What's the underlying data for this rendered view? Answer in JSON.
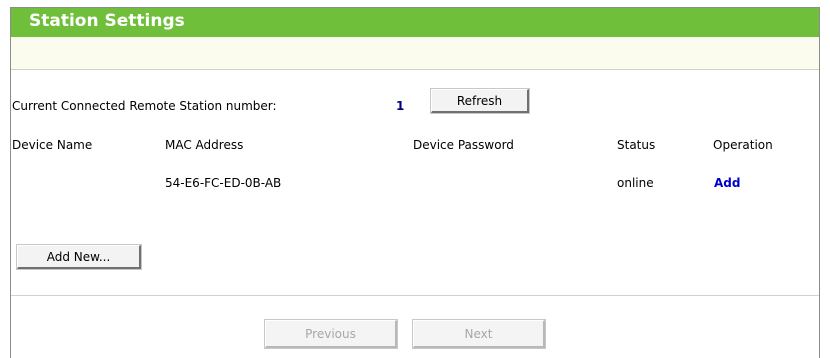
{
  "header": {
    "title": "Station Settings"
  },
  "connected": {
    "label": "Current Connected Remote Station number:",
    "count": "1",
    "refresh_label": "Refresh"
  },
  "table": {
    "columns": [
      "Device Name",
      "MAC Address",
      "Device Password",
      "Status",
      "Operation"
    ],
    "rows": [
      {
        "device_name": "",
        "mac": "54-E6-FC-ED-0B-AB",
        "password": "",
        "status": "online",
        "operation": "Add"
      }
    ]
  },
  "actions": {
    "add_new_label": "Add New...",
    "previous_label": "Previous",
    "next_label": "Next"
  }
}
